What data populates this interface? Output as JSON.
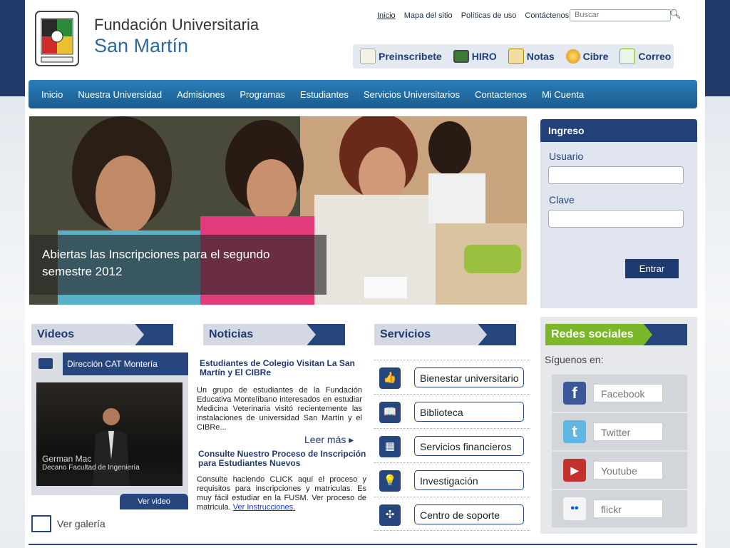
{
  "brand": {
    "line1": "Fundación Universitaria",
    "line2": "San Martín"
  },
  "toplinks": [
    "Inicio",
    "Mapa del sitio",
    "Políticas de uso",
    "Contáctenos"
  ],
  "search": {
    "placeholder": "Buscar"
  },
  "quickbar": [
    {
      "label": "Preinscribete",
      "icon": "form-icon",
      "color": "#f0f0e8"
    },
    {
      "label": "HIRO",
      "icon": "monitor-icon",
      "color": "#3a7a3a"
    },
    {
      "label": "Notas",
      "icon": "clipboard-icon",
      "color": "#f0c040"
    },
    {
      "label": "Cibre",
      "icon": "orb-icon",
      "color": "#f0a020"
    },
    {
      "label": "Correo",
      "icon": "mail-icon",
      "color": "#7ab829"
    }
  ],
  "nav": [
    "Inicio",
    "Nuestra Universidad",
    "Admisiones",
    "Programas",
    "Estudiantes",
    "Servicios Universitarios",
    "Contactenos",
    "Mi Cuenta"
  ],
  "hero": {
    "caption": "Abiertas las Inscripciones para el segundo semestre 2012"
  },
  "login": {
    "title": "Ingreso",
    "user_label": "Usuario",
    "pass_label": "Clave",
    "submit": "Entrar"
  },
  "videos": {
    "title": "Videos",
    "item_title": "Dirección CAT Montería",
    "overlay_name": "German Mac",
    "overlay_role": "Decano Facultad de Ingeniería",
    "watch": "Ver video",
    "gallery": "Ver galería"
  },
  "news": {
    "title": "Noticias",
    "items": [
      {
        "headline": "Estudiantes de Colegio Visitan La San Martín y El CIBRe",
        "body": "Un grupo de estudiantes de la Fundación Educativa Montelíbano interesados en estudiar Medicina Veterinaria visitó recientemente las instalaciones de universidad San Martín y el CIBRe..."
      },
      {
        "headline": "Consulte Nuestro Proceso de Inscripción para Estudiantes Nuevos",
        "body": "Consulte haciendo CLICK aquí el proceso y requisitos para inscripciones y matriculas. Es muy fácil estudiar en la FUSM.",
        "link_prefix": "Ver proceso de matricula.",
        "link": "Ver Instrucciones."
      }
    ],
    "read_more": "Leer más"
  },
  "services": {
    "title": "Servicios",
    "items": [
      {
        "label": "Bienestar universitario",
        "icon": "thumbs-up-icon",
        "glyph": "👍"
      },
      {
        "label": "Biblioteca",
        "icon": "book-icon",
        "glyph": "📖"
      },
      {
        "label": "Servicios financieros",
        "icon": "calculator-icon",
        "glyph": "▦"
      },
      {
        "label": "Investigación",
        "icon": "lightbulb-icon",
        "glyph": "💡"
      },
      {
        "label": "Centro de soporte",
        "icon": "support-icon",
        "glyph": "✣"
      }
    ]
  },
  "social": {
    "title": "Redes sociales",
    "subtitle": "Síguenos en:",
    "items": [
      {
        "label": "Facebook",
        "icon": "facebook-icon",
        "glyph": "f",
        "color": "#3b5998"
      },
      {
        "label": "Twitter",
        "icon": "twitter-icon",
        "glyph": "t",
        "color": "#5fb6e0"
      },
      {
        "label": "Youtube",
        "icon": "youtube-icon",
        "glyph": "▶",
        "color": "#c4302b"
      },
      {
        "label": "flickr",
        "icon": "flickr-icon",
        "glyph": "••",
        "color": "#f4f4f4"
      }
    ]
  }
}
